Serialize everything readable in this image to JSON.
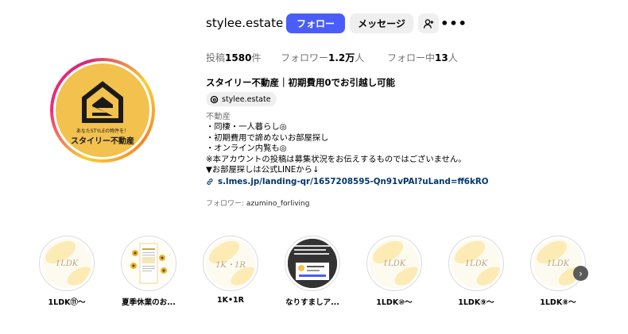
{
  "profile": {
    "username": "stylee.estate",
    "avatar_tagline": "あなたSTYLEの物件を！",
    "avatar_brand": "スタイリー不動産",
    "brand_color": "#f2c14e"
  },
  "actions": {
    "follow_label": "フォロー",
    "message_label": "メッセージ",
    "add_user_icon": "add-user-icon",
    "more_icon": "more-icon",
    "more_glyph": "•••"
  },
  "stats": {
    "posts_label": "投稿",
    "posts_value": "1580",
    "posts_unit": "件",
    "followers_label": "フォロワー",
    "followers_value": "1.2万",
    "followers_unit": "人",
    "following_label": "フォロー中",
    "following_value": "13",
    "following_unit": "人"
  },
  "bio": {
    "full_name": "スタイリー不動産｜初期費用0でお引越し可能",
    "threads_handle": "stylee.estate",
    "category": "不動産",
    "lines": [
      "・同棲・一人暮らし◎",
      "・初期費用で諦めないお部屋探し",
      "・オンライン内覧も◎",
      "※本アカウントの投稿は募集状況をお伝えするものではございません。",
      "▼お部屋探しは公式LINEから↓"
    ],
    "link": "s.lmes.jp/landing-qr/1657208595-Qn91vPAI?uLand=ff6kRO",
    "followed_by_prefix": "フォロワー: ",
    "followed_by_name": "azumino_forliving"
  },
  "highlights": [
    {
      "label": "1LDK⑪～",
      "cover_text": "1LDK"
    },
    {
      "label": "夏季休業のお...",
      "cover_text": ""
    },
    {
      "label": "1K•1R",
      "cover_text": "1K・1R"
    },
    {
      "label": "なりすましア...",
      "cover_text": ""
    },
    {
      "label": "1LDK⑩～",
      "cover_text": "1LDK"
    },
    {
      "label": "1LDK⑨～",
      "cover_text": "1LDK"
    },
    {
      "label": "1LDK⑧～",
      "cover_text": "1LDK"
    }
  ],
  "colors": {
    "follow_button": "#4a5df9",
    "secondary_button": "#efefef",
    "link": "#00376b",
    "muted_text": "#737373"
  }
}
